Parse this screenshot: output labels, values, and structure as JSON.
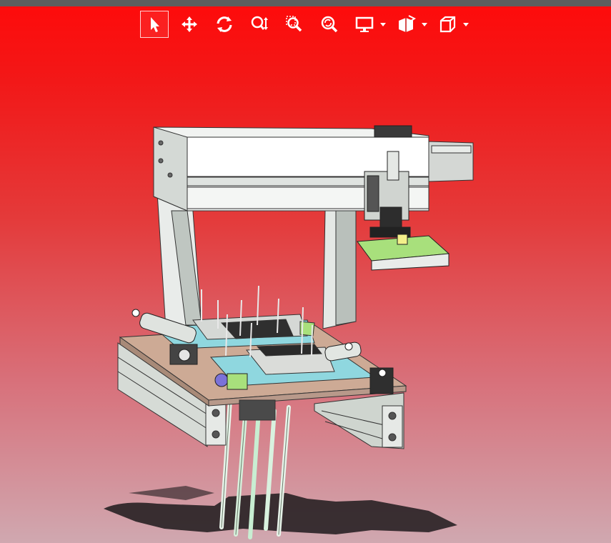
{
  "viewer": {
    "background_top": "#ff0a0a",
    "background_bottom": "#d0a8b0",
    "toolbar_icon_color": "#ffffff"
  },
  "toolbar": {
    "tools": [
      {
        "icon": "select-pointer-icon",
        "active": true
      },
      {
        "icon": "pan-icon",
        "active": false
      },
      {
        "icon": "rotate-icon",
        "active": false
      },
      {
        "icon": "zoom-icon",
        "active": false
      },
      {
        "icon": "zoom-window-icon",
        "active": false
      },
      {
        "icon": "zoom-fit-icon",
        "active": false
      },
      {
        "icon": "display-mode-icon",
        "active": false,
        "dropdown": true
      },
      {
        "icon": "section-view-icon",
        "active": false,
        "dropdown": true
      },
      {
        "icon": "view-cube-icon",
        "active": false,
        "dropdown": true
      }
    ]
  },
  "model": {
    "type": "3D CAD assembly",
    "description_colors": {
      "frame": "#f2f4f2",
      "plate_cyan": "#8fd8df",
      "plate_green": "#a3e07a",
      "base_wood": "#c9a68f",
      "extrusion": "#d8ddd8",
      "shadow": "#1a1a1a"
    }
  }
}
